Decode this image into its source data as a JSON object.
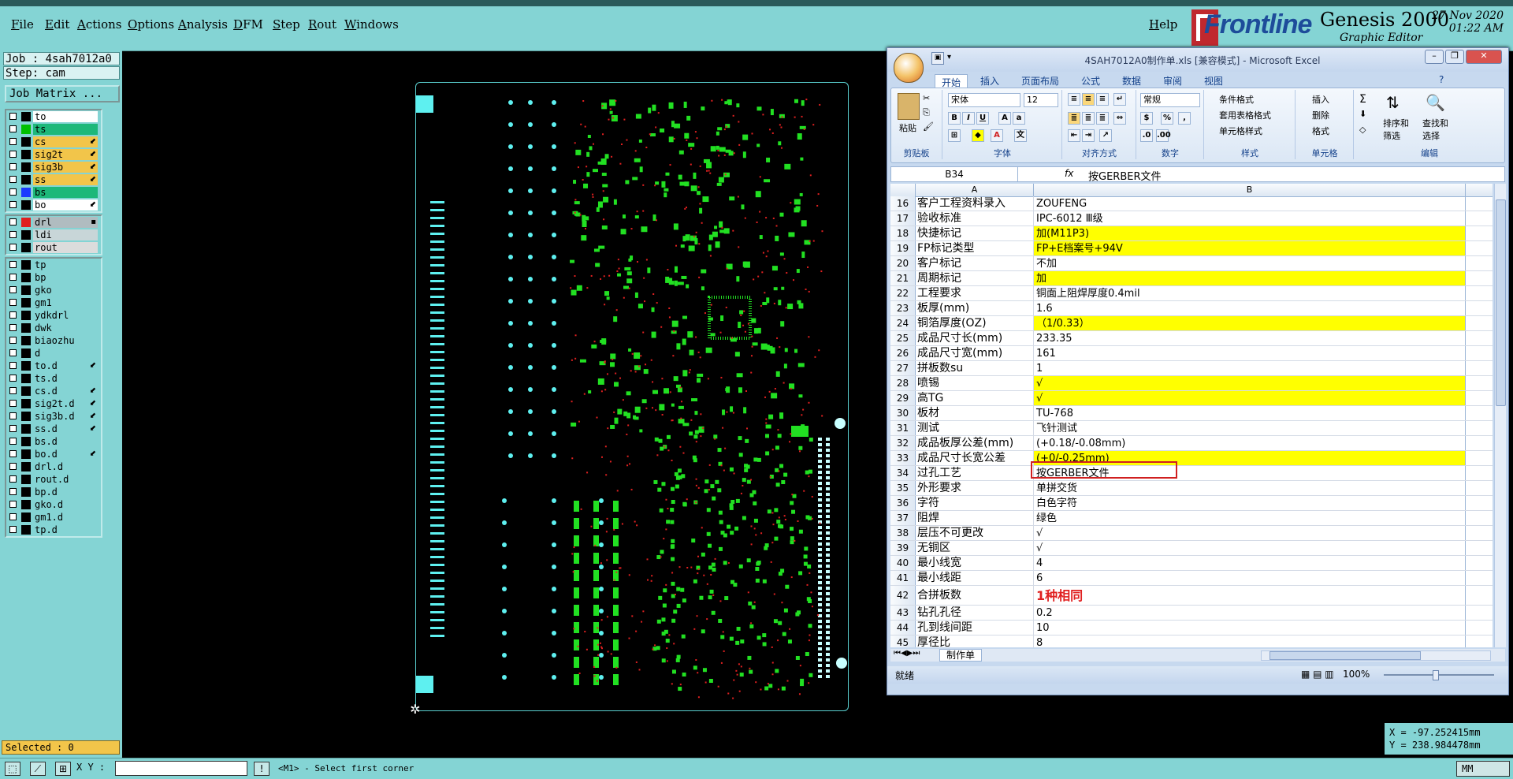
{
  "menu": {
    "items": [
      "File",
      "Edit",
      "Actions",
      "Options",
      "Analysis",
      "DFM",
      "Step",
      "Rout",
      "Windows"
    ],
    "help": "Help"
  },
  "logo": {
    "brand": "Frontline",
    "product": "Genesis 2000",
    "subtitle": "Graphic Editor",
    "date": "27 Nov 2020",
    "time": "01:22 AM"
  },
  "left_panel": {
    "job": "Job : 4sah7012a0",
    "step": "Step: cam",
    "job_matrix": "Job Matrix ...",
    "groups": [
      [
        {
          "name": "to",
          "swatch": "#000000",
          "bg": "#ffffff",
          "mark": ""
        },
        {
          "name": "ts",
          "swatch": "#00c000",
          "bg": "#1db87a",
          "mark": ""
        },
        {
          "name": "cs",
          "swatch": "#000000",
          "bg": "#f2c54a",
          "mark": "⬋"
        },
        {
          "name": "sig2t",
          "swatch": "#000000",
          "bg": "#f2c54a",
          "mark": "⬋"
        },
        {
          "name": "sig3b",
          "swatch": "#000000",
          "bg": "#f2c54a",
          "mark": "⬋"
        },
        {
          "name": "ss",
          "swatch": "#000000",
          "bg": "#f2c54a",
          "mark": "⬋"
        },
        {
          "name": "bs",
          "swatch": "#1a3aff",
          "bg": "#1db87a",
          "mark": ""
        },
        {
          "name": "bo",
          "swatch": "#000000",
          "bg": "#ffffff",
          "mark": "⬋"
        }
      ],
      [
        {
          "name": "drl",
          "swatch": "#e02020",
          "bg": "#b0bcc0",
          "mark": "▪"
        },
        {
          "name": "ldi",
          "swatch": "#000000",
          "bg": "#c8d6d8",
          "mark": ""
        },
        {
          "name": "rout",
          "swatch": "#000000",
          "bg": "#dcdcdc",
          "mark": ""
        }
      ],
      [
        {
          "name": "tp",
          "swatch": "#000000",
          "bg": "#84d4d4",
          "mark": ""
        },
        {
          "name": "bp",
          "swatch": "#000000",
          "bg": "#84d4d4",
          "mark": ""
        },
        {
          "name": "gko",
          "swatch": "#000000",
          "bg": "#84d4d4",
          "mark": ""
        },
        {
          "name": "gm1",
          "swatch": "#000000",
          "bg": "#84d4d4",
          "mark": ""
        },
        {
          "name": "ydkdrl",
          "swatch": "#000000",
          "bg": "#84d4d4",
          "mark": ""
        },
        {
          "name": "dwk",
          "swatch": "#000000",
          "bg": "#84d4d4",
          "mark": ""
        },
        {
          "name": "biaozhu",
          "swatch": "#000000",
          "bg": "#84d4d4",
          "mark": ""
        },
        {
          "name": "d",
          "swatch": "#000000",
          "bg": "#84d4d4",
          "mark": ""
        },
        {
          "name": "to.d",
          "swatch": "#000000",
          "bg": "#84d4d4",
          "mark": "⬋"
        },
        {
          "name": "ts.d",
          "swatch": "#000000",
          "bg": "#84d4d4",
          "mark": ""
        },
        {
          "name": "cs.d",
          "swatch": "#000000",
          "bg": "#84d4d4",
          "mark": "⬋"
        },
        {
          "name": "sig2t.d",
          "swatch": "#000000",
          "bg": "#84d4d4",
          "mark": "⬋"
        },
        {
          "name": "sig3b.d",
          "swatch": "#000000",
          "bg": "#84d4d4",
          "mark": "⬋"
        },
        {
          "name": "ss.d",
          "swatch": "#000000",
          "bg": "#84d4d4",
          "mark": "⬋"
        },
        {
          "name": "bs.d",
          "swatch": "#000000",
          "bg": "#84d4d4",
          "mark": ""
        },
        {
          "name": "bo.d",
          "swatch": "#000000",
          "bg": "#84d4d4",
          "mark": "⬋"
        },
        {
          "name": "drl.d",
          "swatch": "#000000",
          "bg": "#84d4d4",
          "mark": ""
        },
        {
          "name": "rout.d",
          "swatch": "#000000",
          "bg": "#84d4d4",
          "mark": ""
        },
        {
          "name": "bp.d",
          "swatch": "#000000",
          "bg": "#84d4d4",
          "mark": ""
        },
        {
          "name": "gko.d",
          "swatch": "#000000",
          "bg": "#84d4d4",
          "mark": ""
        },
        {
          "name": "gm1.d",
          "swatch": "#000000",
          "bg": "#84d4d4",
          "mark": ""
        },
        {
          "name": "tp.d",
          "swatch": "#000000",
          "bg": "#84d4d4",
          "mark": ""
        }
      ]
    ],
    "selected": "Selected : 0"
  },
  "coords": {
    "x": "X = -97.252415mm",
    "y": "Y = 238.984478mm"
  },
  "status_bar": {
    "xy_label": "X Y :",
    "xy_value": "",
    "prompt": "<M1> - Select first corner",
    "unit": "MM",
    "icons": [
      "zoom-box-icon",
      "measure-icon",
      "grid-icon",
      "info-icon"
    ]
  },
  "excel": {
    "title": "4SAH7012A0制作单.xls [兼容模式] - Microsoft Excel",
    "tabs": [
      "开始",
      "插入",
      "页面布局",
      "公式",
      "数据",
      "审阅",
      "视图"
    ],
    "ribbon": {
      "paste": "粘贴",
      "clipboard": "剪贴板",
      "font_name": "宋体",
      "font_size": "12",
      "font_group": "字体",
      "align_group": "对齐方式",
      "number_format": "常规",
      "number_group": "数字",
      "cond_format": "条件格式",
      "table_format": "套用表格格式",
      "cell_style": "单元格样式",
      "style_group": "样式",
      "insert": "插入",
      "delete": "删除",
      "format": "格式",
      "cells_group": "单元格",
      "sort_filter": "排序和\n筛选",
      "find_select": "查找和\n选择",
      "edit_group": "编辑"
    },
    "name_box": "B34",
    "formula": "按GERBER文件",
    "columns": [
      "A",
      "B"
    ],
    "rows": [
      {
        "n": "16",
        "a": "客户工程资料录入",
        "b": "ZOUFENG",
        "style": ""
      },
      {
        "n": "17",
        "a": "验收标准",
        "b": "IPC-6012 Ⅲ级",
        "style": ""
      },
      {
        "n": "18",
        "a": "快捷标记",
        "b": "加(M11P3)",
        "style": "y"
      },
      {
        "n": "19",
        "a": "FP标记类型",
        "b": "FP+E档案号+94V",
        "style": "y"
      },
      {
        "n": "20",
        "a": "客户标记",
        "b": "不加",
        "style": ""
      },
      {
        "n": "21",
        "a": "周期标记",
        "b": "加",
        "style": "y"
      },
      {
        "n": "22",
        "a": "工程要求",
        "b": "铜面上阻焊厚度0.4mil",
        "style": ""
      },
      {
        "n": "23",
        "a": "板厚(mm)",
        "b": "1.6",
        "style": ""
      },
      {
        "n": "24",
        "a": "铜箔厚度(OZ)",
        "b": "（1/0.33）",
        "style": "y"
      },
      {
        "n": "25",
        "a": "成品尺寸长(mm)",
        "b": "233.35",
        "style": ""
      },
      {
        "n": "26",
        "a": "成品尺寸宽(mm)",
        "b": "161",
        "style": ""
      },
      {
        "n": "27",
        "a": "拼板数su",
        "b": "1",
        "style": ""
      },
      {
        "n": "28",
        "a": "喷锡",
        "b": "√",
        "style": "y"
      },
      {
        "n": "29",
        "a": "高TG",
        "b": "√",
        "style": "y"
      },
      {
        "n": "30",
        "a": "板材",
        "b": "TU-768",
        "style": ""
      },
      {
        "n": "31",
        "a": "测试",
        "b": "飞针测试",
        "style": ""
      },
      {
        "n": "32",
        "a": "成品板厚公差(mm)",
        "b": "(+0.18/-0.08mm)",
        "style": ""
      },
      {
        "n": "33",
        "a": "成品尺寸长宽公差",
        "b": "(+0/-0.25mm)",
        "style": "y"
      },
      {
        "n": "34",
        "a": "过孔工艺",
        "b": "按GERBER文件",
        "style": ""
      },
      {
        "n": "35",
        "a": "外形要求",
        "b": "单拼交货",
        "style": ""
      },
      {
        "n": "36",
        "a": "字符",
        "b": "白色字符",
        "style": ""
      },
      {
        "n": "37",
        "a": "阻焊",
        "b": "绿色",
        "style": ""
      },
      {
        "n": "38",
        "a": "层压不可更改",
        "b": "√",
        "style": ""
      },
      {
        "n": "39",
        "a": "无铜区",
        "b": "√",
        "style": ""
      },
      {
        "n": "40",
        "a": "最小线宽",
        "b": "4",
        "style": ""
      },
      {
        "n": "41",
        "a": "最小线距",
        "b": "6",
        "style": ""
      },
      {
        "n": "42",
        "a": "合拼板数",
        "b": "1种相同",
        "style": "red"
      },
      {
        "n": "43",
        "a": "钻孔孔径",
        "b": "0.2",
        "style": ""
      },
      {
        "n": "44",
        "a": "孔到线间距",
        "b": "10",
        "style": ""
      },
      {
        "n": "45",
        "a": "厚径比",
        "b": "8",
        "style": ""
      }
    ],
    "sheet_tab": "制作单",
    "status": "就绪",
    "zoom": "100%"
  }
}
